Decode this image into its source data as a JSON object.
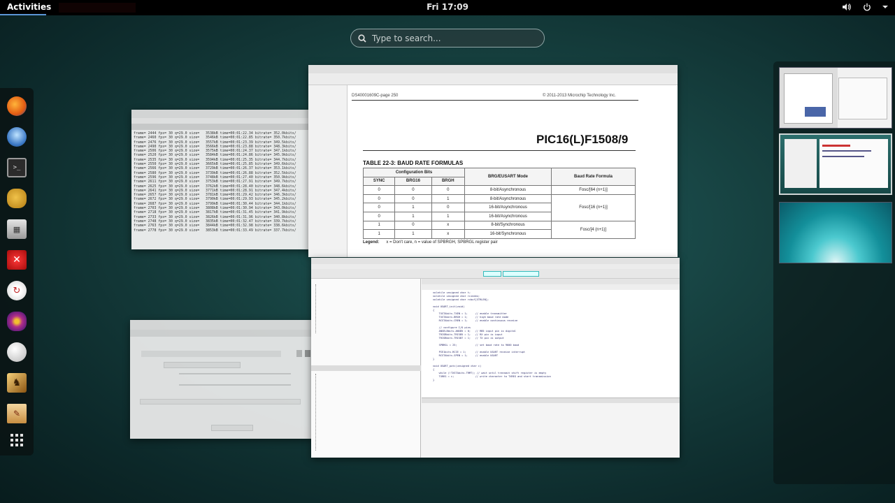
{
  "topbar": {
    "activities_label": "Activities",
    "clock": "Fri 17:09",
    "tray_icons": [
      "volume-icon",
      "power-icon",
      "chevron-down-icon"
    ]
  },
  "search": {
    "placeholder": "Type to search..."
  },
  "dash": {
    "apps": [
      "firefox-icon",
      "thunderbird-icon",
      "terminal-icon",
      "gimp-icon",
      "calculator-icon",
      "tool-icon",
      "update-icon",
      "games-icon",
      "baseball-icon",
      "chess-icon",
      "draw-icon",
      "show-apps-icon"
    ]
  },
  "pdf": {
    "header_left": "DS40001609C-page 250",
    "header_right": "© 2011-2013 Microchip Technology Inc.",
    "device_title": "PIC16(L)F1508/9",
    "table_caption": "TABLE 22-3:    BAUD RATE FORMULAS",
    "table": {
      "group_header": "Configuration Bits",
      "col_sync": "SYNC",
      "col_brg16": "BRG16",
      "col_brgh": "BRGH",
      "col_mode": "BRG/EUSART Mode",
      "col_formula": "Baud Rate Formula",
      "rows": [
        {
          "sync": "0",
          "brg16": "0",
          "brgh": "0",
          "mode": "8-bit/Asynchronous"
        },
        {
          "sync": "0",
          "brg16": "0",
          "brgh": "1",
          "mode": "8-bit/Asynchronous"
        },
        {
          "sync": "0",
          "brg16": "1",
          "brgh": "0",
          "mode": "16-bit/Asynchronous"
        },
        {
          "sync": "0",
          "brg16": "1",
          "brgh": "1",
          "mode": "16-bit/Asynchronous"
        },
        {
          "sync": "1",
          "brg16": "0",
          "brgh": "x",
          "mode": "8-bit/Synchronous"
        },
        {
          "sync": "1",
          "brg16": "1",
          "brgh": "x",
          "mode": "16-bit/Synchronous"
        }
      ],
      "formulas": [
        "Fosc/[64 (n+1)]",
        "Fosc/[16 (n+1)]",
        "Fosc/[4 (n+1)]"
      ]
    },
    "legend_label": "Legend:",
    "legend_text": "x = Don't care, n = value of SPBRGH, SPBRGL register pair"
  },
  "terminal": {
    "lines": [
      "frame= 2444 fps= 30 q=29.0 size=   3538kB time=00:01:22.34 bitrate= 352.0kbits/",
      "frame= 2460 fps= 30 q=29.0 size=   3546kB time=00:01:22.85 bitrate= 350.7kbits/",
      "frame= 2476 fps= 30 q=29.0 size=   3557kB time=00:01:23.39 bitrate= 349.5kbits/",
      "frame= 2490 fps= 30 q=29.0 size=   3566kB time=00:01:23.88 bitrate= 348.3kbits/",
      "frame= 2506 fps= 30 q=29.0 size=   3575kB time=00:01:24.37 bitrate= 347.1kbits/",
      "frame= 2520 fps= 30 q=29.0 size=   3584kB time=00:01:24.86 bitrate= 345.9kbits/",
      "frame= 2535 fps= 30 q=29.0 size=   3594kB time=00:01:25.35 bitrate= 344.7kbits/",
      "frame= 2550 fps= 30 q=29.0 size=   3665kB time=00:01:25.85 bitrate= 349.6kbits/",
      "frame= 2566 fps= 30 q=29.0 size=   3729kB time=00:01:26.37 bitrate= 353.1kbits/",
      "frame= 2580 fps= 30 q=29.0 size=   3739kB time=00:01:26.88 bitrate= 352.5kbits/",
      "frame= 2596 fps= 30 q=29.0 size=   3748kB time=00:01:27.40 bitrate= 350.9kbits/",
      "frame= 2611 fps= 30 q=29.0 size=   3753kB time=00:01:27.91 bitrate= 349.7kbits/",
      "frame= 2625 fps= 30 q=29.0 size=   3762kB time=00:01:28.40 bitrate= 348.6kbits/",
      "frame= 2641 fps= 30 q=29.0 size=   3771kB time=00:01:28.91 bitrate= 347.4kbits/",
      "frame= 2657 fps= 30 q=29.0 size=   3781kB time=00:01:29.42 bitrate= 346.3kbits/",
      "frame= 2672 fps= 30 q=29.0 size=   3790kB time=00:01:29.93 bitrate= 345.2kbits/",
      "frame= 2687 fps= 30 q=29.0 size=   3799kB time=00:01:30.44 bitrate= 344.1kbits/",
      "frame= 2703 fps= 30 q=29.0 size=   3808kB time=00:01:30.94 bitrate= 343.0kbits/",
      "frame= 2718 fps= 30 q=29.0 size=   3817kB time=00:01:31.45 bitrate= 341.9kbits/",
      "frame= 2733 fps= 30 q=29.0 size=   3826kB time=00:01:31.96 bitrate= 340.8kbits/",
      "frame= 2748 fps= 30 q=29.0 size=   3835kB time=00:01:32.47 bitrate= 339.7kbits/",
      "frame= 2763 fps= 30 q=29.0 size=   3844kB time=00:01:32.98 bitrate= 338.6kbits/",
      "frame= 2778 fps= 30 q=29.0 size=   3853kB time=00:01:33.49 bitrate= 337.7kbits/"
    ]
  },
  "ide": {
    "code": [
      "volatile unsigned char t;",
      "volatile unsigned char rcindex;",
      "volatile unsigned char rcbuf[STRLEN];",
      "",
      "void USART_init(void)",
      "{",
      "    TXSTAbits.TXEN = 1;     // enable transmitter",
      "    TXSTAbits.BRGH = 1;     // high baud rate mode",
      "    RCSTAbits.CREN = 1;     // enable continuous receive",
      "",
      "    // configure I/O pins",
      "    ANSELBbits.ANSB5 = 0;   // RB5 input pin is digital",
      "    TRISBbits.TRISB5 = 1;   // RX pin is input",
      "    TRISBbits.TRISB7 = 1;   // TX pin is output",
      "",
      "    SPBRGL = 25;            // set baud rate to 9600 baud",
      "",
      "    PIE1bits.RCIE = 1;      // enable USART receive interrupt",
      "    RCSTAbits.SPEN = 1;     // enable USART",
      "}",
      "",
      "void USART_putc(unsigned char c)",
      "{",
      "    while (!TXSTAbits.TRMT); // wait until transmit shift register is empty",
      "    TXREG = c;              // write character to TXREG and start transmission",
      "}"
    ]
  }
}
